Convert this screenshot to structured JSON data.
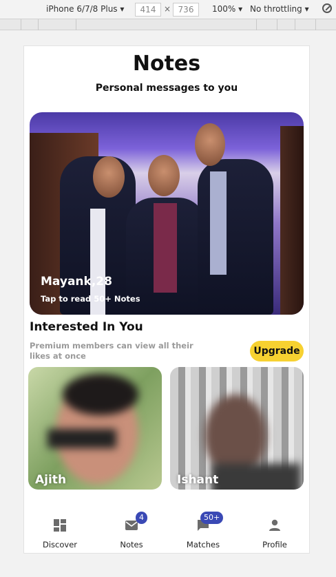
{
  "devtools": {
    "device": "iPhone 6/7/8 Plus",
    "width": "414",
    "height": "736",
    "zoom": "100%",
    "throttling": "No throttling"
  },
  "header": {
    "title": "Notes",
    "subtitle": "Personal messages to you"
  },
  "featured": {
    "name": "Mayank,28",
    "cta": "Tap to read 50+ Notes"
  },
  "interested": {
    "title": "Interested In You",
    "subtitle": "Premium members can view all their likes at once",
    "upgrade_label": "Upgrade",
    "cards": [
      {
        "name": "Ajith"
      },
      {
        "name": "Ishant"
      }
    ]
  },
  "nav": {
    "items": [
      {
        "label": "Discover",
        "badge": ""
      },
      {
        "label": "Notes",
        "badge": "4"
      },
      {
        "label": "Matches",
        "badge": "50+"
      },
      {
        "label": "Profile",
        "badge": ""
      }
    ]
  },
  "colors": {
    "accent": "#f7d131",
    "badge": "#3a49b5",
    "icon": "#6b6b6b"
  }
}
